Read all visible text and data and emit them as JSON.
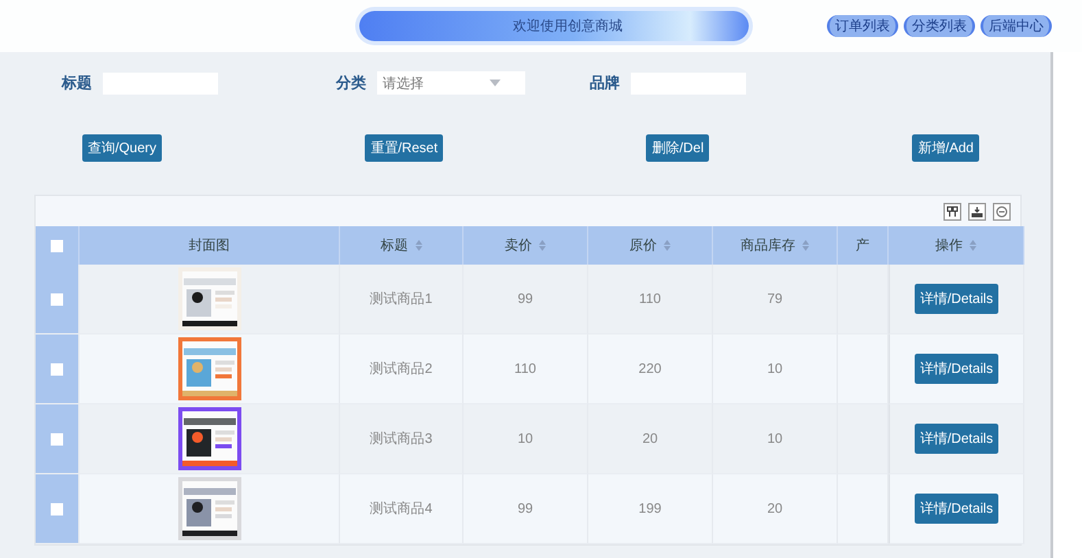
{
  "header": {
    "title": "欢迎使用创意商城",
    "nav": [
      "订单列表",
      "分类列表",
      "后端中心"
    ]
  },
  "filters": [
    {
      "label": "标题",
      "kind": "text"
    },
    {
      "label": "分类",
      "kind": "select",
      "placeholder": "请选择"
    },
    {
      "label": "品牌",
      "kind": "text"
    }
  ],
  "actions": [
    "查询/Query",
    "重置/Reset",
    "删除/Del",
    "新增/Add"
  ],
  "table": {
    "select_all": {
      "checked": false
    },
    "columns": [
      {
        "label": "封面图",
        "sortable": false
      },
      {
        "label": "标题",
        "sortable": true
      },
      {
        "label": "卖价",
        "sortable": true
      },
      {
        "label": "原价",
        "sortable": true
      },
      {
        "label": "商品库存",
        "sortable": true
      },
      {
        "label": "产",
        "sortable": false
      },
      {
        "label": "操作",
        "sortable": true
      }
    ],
    "rows": [
      {
        "checked": false,
        "title": "测试商品1",
        "price": "99",
        "original_price": "110",
        "stock": "79",
        "action": "详情/Details"
      },
      {
        "checked": false,
        "title": "测试商品2",
        "price": "110",
        "original_price": "220",
        "stock": "10",
        "action": "详情/Details"
      },
      {
        "checked": false,
        "title": "测试商品3",
        "price": "10",
        "original_price": "20",
        "stock": "10",
        "action": "详情/Details"
      },
      {
        "checked": false,
        "title": "测试商品4",
        "price": "99",
        "original_price": "199",
        "stock": "20",
        "action": "详情/Details"
      }
    ]
  }
}
